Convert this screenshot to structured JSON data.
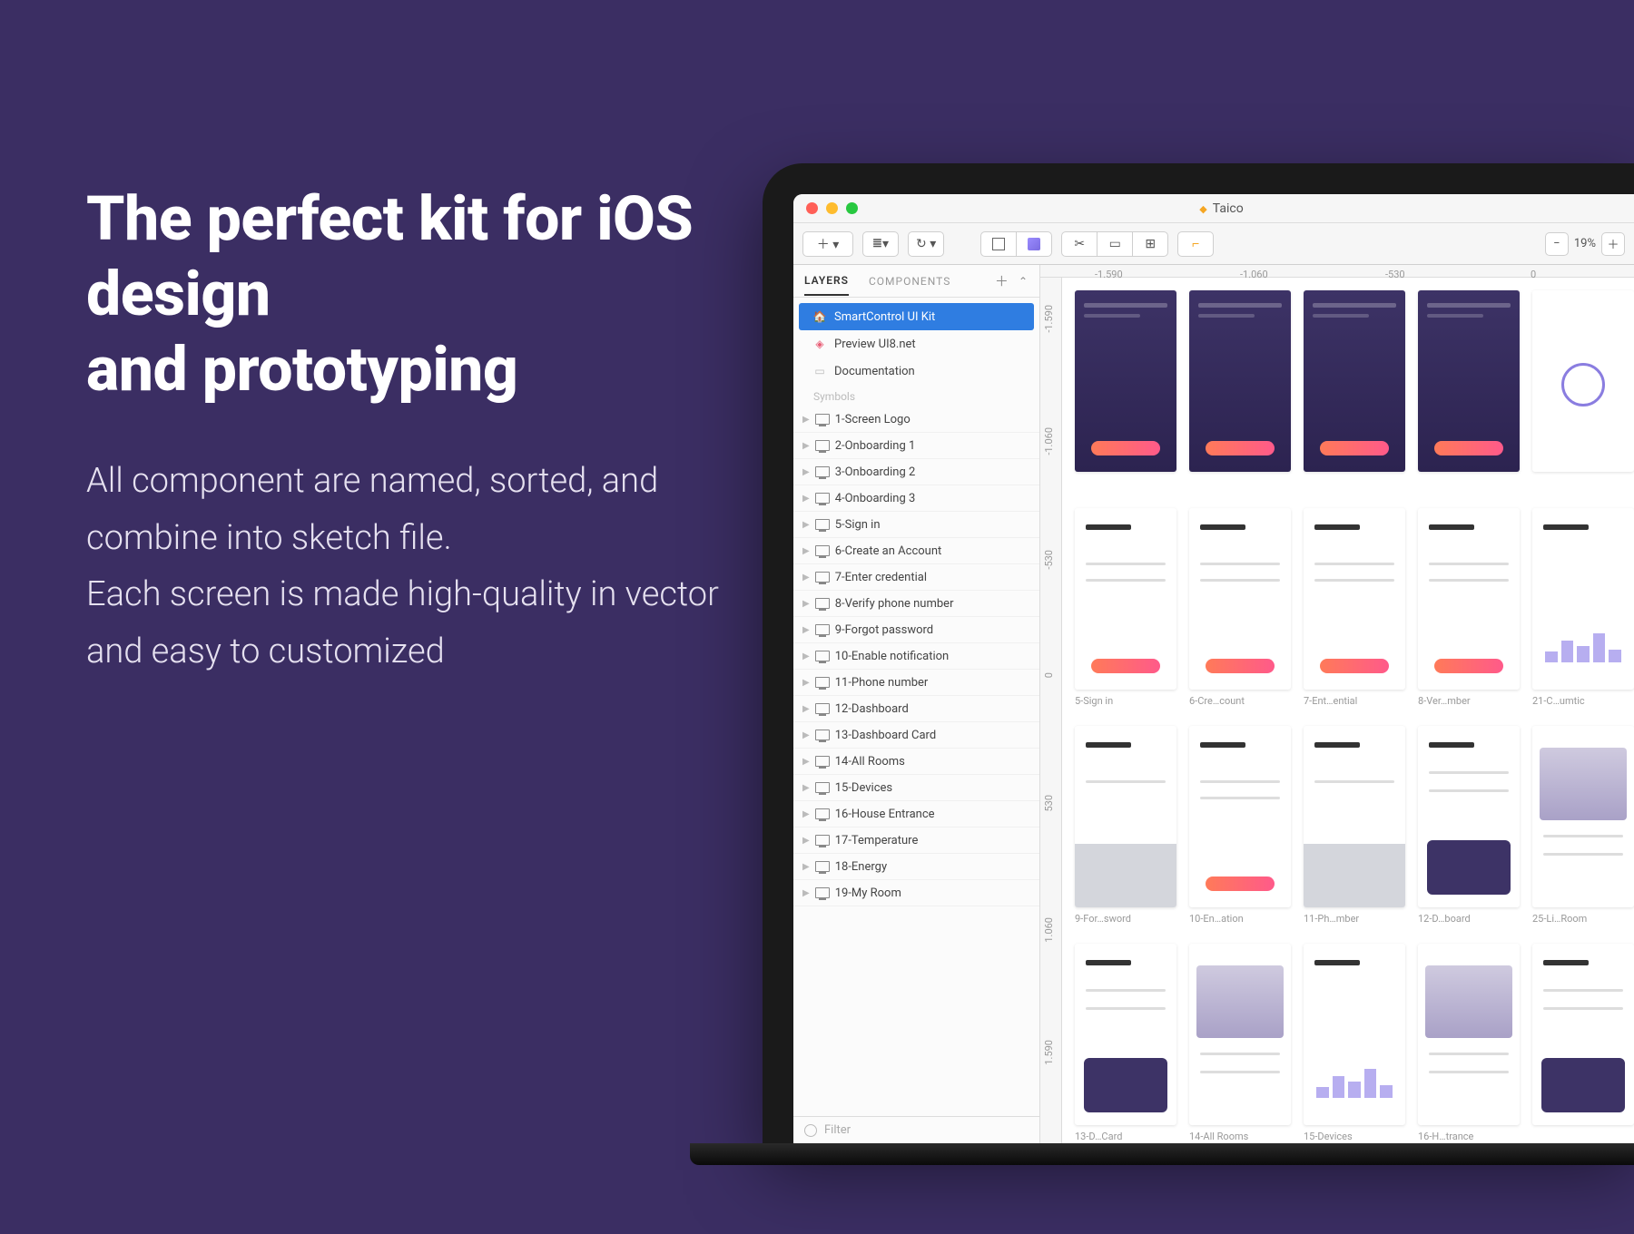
{
  "hero": {
    "title": "The perfect kit for iOS design\nand prototyping",
    "body": "All component are named, sorted, and combine into sketch file.\nEach screen is made high-quality in vector and easy to customized"
  },
  "window": {
    "doc_title": "Taico",
    "zoom": "19%"
  },
  "sidebar": {
    "tab_layers": "LAYERS",
    "tab_components": "COMPONENTS",
    "pages": [
      {
        "icon": "home",
        "label": "SmartControl UI Kit",
        "selected": true
      },
      {
        "icon": "prev",
        "label": "Preview UI8.net",
        "selected": false
      },
      {
        "icon": "doc",
        "label": "Documentation",
        "selected": false
      }
    ],
    "symbols_label": "Symbols",
    "layers": [
      "1-Screen Logo",
      "2-Onboarding 1",
      "3-Onboarding 2",
      "4-Onboarding 3",
      "5-Sign in",
      "6-Create an Account",
      "7-Enter credential",
      "8-Verify phone number",
      "9-Forgot password",
      "10-Enable notification",
      "11-Phone number",
      "12-Dashboard",
      "13-Dashboard Card",
      "14-All Rooms",
      "15-Devices",
      "16-House Entrance",
      "17-Temperature",
      "18-Energy",
      "19-My Room"
    ],
    "filter": "Filter"
  },
  "ruler": {
    "h": [
      "-1.590",
      "-1.060",
      "-530",
      "0"
    ],
    "v": [
      "-1.590",
      "-1.060",
      "-530",
      "0",
      "530",
      "1.060",
      "1.590"
    ]
  },
  "artboards": {
    "row1": [
      {
        "label": "",
        "style": "dark"
      },
      {
        "label": "",
        "style": "dark"
      },
      {
        "label": "",
        "style": "dark"
      },
      {
        "label": "",
        "style": "dark"
      },
      {
        "label": "",
        "style": "wht-circ"
      }
    ],
    "row2": [
      {
        "label": "5-Sign in",
        "style": "wht-form"
      },
      {
        "label": "6-Cre…count",
        "style": "wht-form"
      },
      {
        "label": "7-Ent…ential",
        "style": "wht-form"
      },
      {
        "label": "8-Ver…mber",
        "style": "wht-form"
      },
      {
        "label": "21-C…umtic",
        "style": "wht-bars"
      }
    ],
    "row3": [
      {
        "label": "9-For…sword",
        "style": "wht-kb"
      },
      {
        "label": "10-En…ation",
        "style": "wht-form"
      },
      {
        "label": "11-Ph…mber",
        "style": "wht-kb"
      },
      {
        "label": "12-D…board",
        "style": "wht-dash"
      },
      {
        "label": "25-Li…Room",
        "style": "wht-photo"
      }
    ],
    "row4": [
      {
        "label": "13-D…Card",
        "style": "wht-dash"
      },
      {
        "label": "14-All Rooms",
        "style": "wht-photo"
      },
      {
        "label": "15-Devices",
        "style": "wht-bars"
      },
      {
        "label": "16-H…trance",
        "style": "wht-photo"
      },
      {
        "label": "",
        "style": "wht-dash"
      }
    ]
  }
}
